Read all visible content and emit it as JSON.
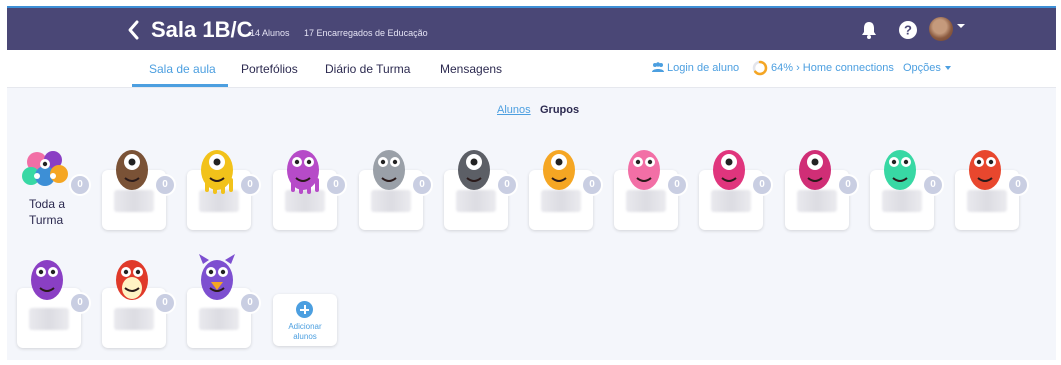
{
  "header": {
    "class_name": "Sala 1B/C",
    "students_count": "14 Alunos",
    "parents_count": "17 Encarregados de Educação"
  },
  "nav": {
    "tabs": [
      {
        "label": "Sala de aula",
        "active": true
      },
      {
        "label": "Portefólios",
        "active": false
      },
      {
        "label": "Diário de Turma",
        "active": false
      },
      {
        "label": "Mensagens",
        "active": false
      }
    ],
    "student_login": "Login de aluno",
    "home_connections": "64% › Home connections",
    "home_connections_percent": 64,
    "options": "Opções"
  },
  "view_toggle": {
    "students": "Alunos",
    "groups": "Grupos"
  },
  "whole_class": {
    "label_line1": "Toda a",
    "label_line2": "Turma",
    "points": "0"
  },
  "students": [
    {
      "monster": "brown-furry-monster-icon",
      "color": "#7a5236",
      "points": "0"
    },
    {
      "monster": "yellow-octopus-monster-icon",
      "color": "#f2c21a",
      "points": "0"
    },
    {
      "monster": "purple-jellyfish-monster-icon",
      "color": "#b64bc8",
      "points": "0"
    },
    {
      "monster": "grey-robot-monster-icon",
      "color": "#9aa0a8",
      "points": "0"
    },
    {
      "monster": "dark-grey-cyclops-monster-icon",
      "color": "#5c5f66",
      "points": "0"
    },
    {
      "monster": "orange-flame-monster-icon",
      "color": "#f5a623",
      "points": "0"
    },
    {
      "monster": "pink-blob-monster-icon",
      "color": "#f26fa6",
      "points": "0"
    },
    {
      "monster": "magenta-eye-monster-icon",
      "color": "#e0357d",
      "points": "0"
    },
    {
      "monster": "magenta-cone-monster-icon",
      "color": "#d02e76",
      "points": "0"
    },
    {
      "monster": "green-ghost-monster-icon",
      "color": "#38d8a4",
      "points": "0"
    },
    {
      "monster": "red-square-monster-icon",
      "color": "#e8472e",
      "points": "0"
    },
    {
      "monster": "purple-owl-monster-icon",
      "color": "#8a3fc4",
      "points": "0"
    },
    {
      "monster": "red-penguin-monster-icon",
      "color": "#e03a2a",
      "points": "0"
    },
    {
      "monster": "purple-horned-monster-icon",
      "color": "#7d4fd0",
      "points": "0"
    }
  ],
  "add_students": {
    "line1": "Adicionar",
    "line2": "alunos"
  },
  "colors": {
    "header_bg": "#4a4776",
    "accent": "#4c9fe0",
    "badge": "#c9cee2"
  }
}
